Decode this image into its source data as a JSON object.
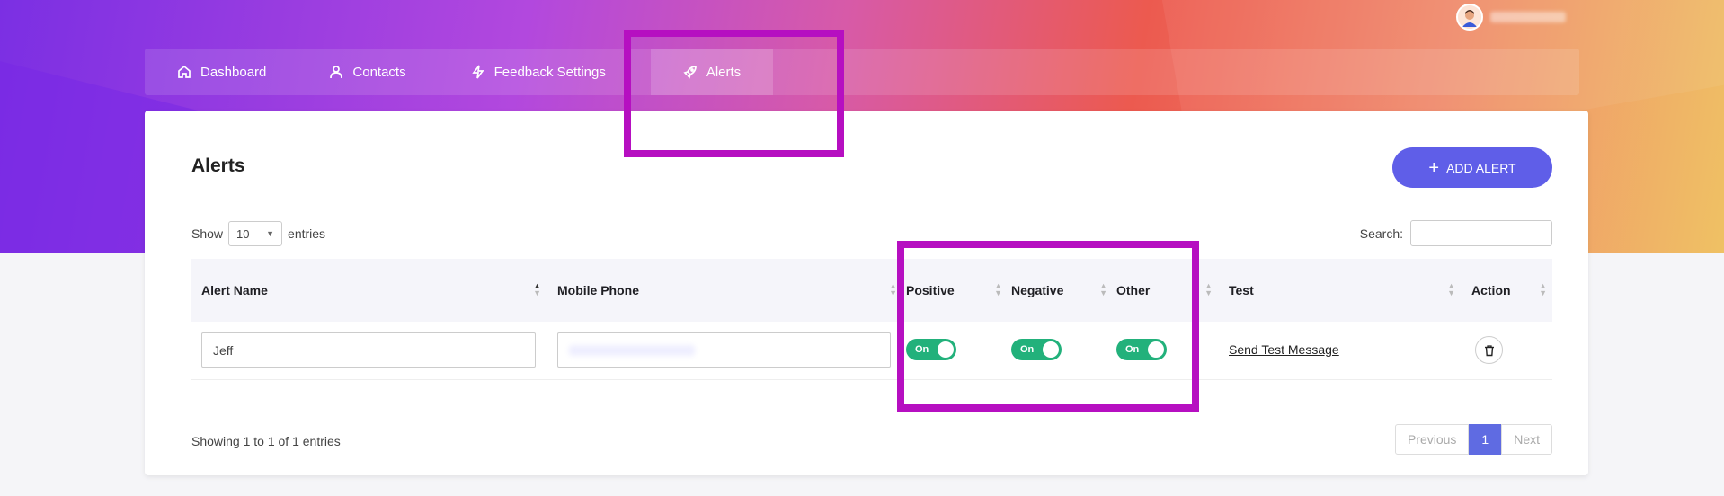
{
  "colors": {
    "accent": "#5f5ee8",
    "toggle_on": "#22b17b",
    "highlight": "#b60fc1",
    "pager_active": "#5f6be2"
  },
  "nav": {
    "items": [
      {
        "label": "Dashboard",
        "icon": "home-icon"
      },
      {
        "label": "Contacts",
        "icon": "user-icon"
      },
      {
        "label": "Feedback Settings",
        "icon": "lightning-icon"
      },
      {
        "label": "Alerts",
        "icon": "rocket-icon",
        "active": true
      }
    ]
  },
  "page": {
    "title": "Alerts",
    "add_button": "ADD ALERT"
  },
  "table_controls": {
    "show_label": "Show",
    "entries_value": "10",
    "entries_label": "entries",
    "search_label": "Search:"
  },
  "table": {
    "headers": [
      "Alert Name",
      "Mobile Phone",
      "Positive",
      "Negative",
      "Other",
      "Test",
      "Action"
    ],
    "rows": [
      {
        "alert_name": "Jeff",
        "positive": "On",
        "negative": "On",
        "other": "On",
        "test_link": "Send Test Message"
      }
    ]
  },
  "footer": {
    "info": "Showing 1 to 1 of 1 entries",
    "prev": "Previous",
    "page": "1",
    "next": "Next"
  }
}
